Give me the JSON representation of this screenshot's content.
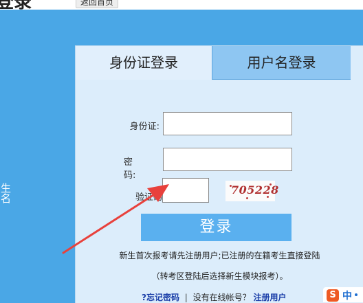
{
  "topbar": {
    "title": "登录",
    "back_label": "返回首页"
  },
  "side_text": "生名",
  "tabs": [
    {
      "label": "身份证登录"
    },
    {
      "label": "用户名登录"
    }
  ],
  "form": {
    "id_label": "身份证:",
    "password_label": "密　　码:",
    "captcha_label": "验证码",
    "id_value": "",
    "password_value": "",
    "captcha_value": "",
    "captcha_text": "705228",
    "login_label": "登录"
  },
  "notes": {
    "line1": "新生首次报考请先注册用户;已注册的在籍考生直接登陆",
    "line2": "（转考区登陆后选择新生模块报考）。"
  },
  "links": {
    "forgot": "?忘记密码",
    "separator": "|",
    "no_account": "没有在线帐号？",
    "register": "注册用户"
  },
  "ime": {
    "logo": "S",
    "mode": "中"
  },
  "colors": {
    "background": "#4aa7e6",
    "panel": "#dcedfb",
    "active_tab": "#e1effc",
    "inactive_tab": "#8ec6f2",
    "login_button": "#5ab0ef",
    "arrow": "#e8413c",
    "link": "#1a3ea8"
  }
}
